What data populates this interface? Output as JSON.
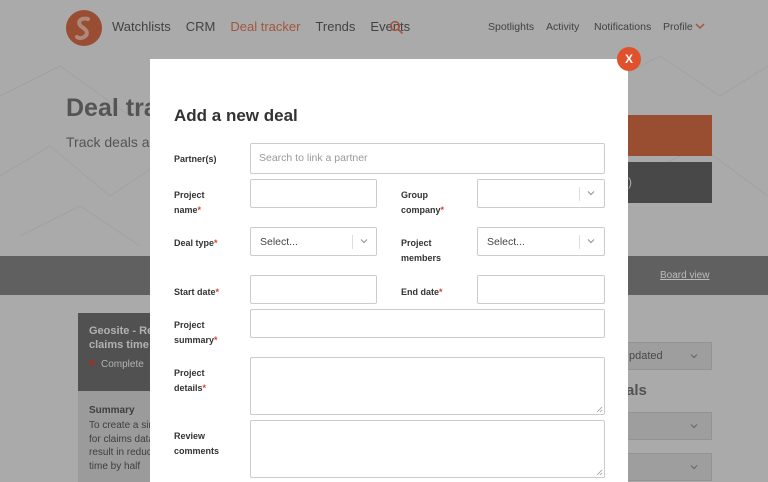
{
  "nav": {
    "items": [
      "Watchlists",
      "CRM",
      "Deal tracker",
      "Trends",
      "Events"
    ],
    "active": "Deal tracker",
    "right": [
      "Spotlights",
      "Activity",
      "Notifications",
      "Profile"
    ]
  },
  "hero": {
    "title": "Deal tra",
    "subtitle": "Track deals a",
    "gray_button_fragment": ")"
  },
  "band": {
    "board_view": "Board view"
  },
  "card": {
    "title": "Geosite - Rec claims time",
    "status": "Complete",
    "summary_label": "Summary",
    "summary": "To create a sin for claims data result in reduc time by half"
  },
  "sidebar": {
    "sort_value": "pdated",
    "filters_title": "als"
  },
  "modal": {
    "title": "Add a new deal",
    "close_label": "X",
    "required_mark": "*",
    "labels": {
      "partners": "Partner(s)",
      "project_name": "Project name",
      "group_company": "Group company",
      "deal_type": "Deal type",
      "project_members": "Project members",
      "start_date": "Start date",
      "end_date": "End date",
      "project_summary": "Project summary",
      "project_details": "Project details",
      "review_comments": "Review comments"
    },
    "placeholders": {
      "partners": "Search to link a partner"
    },
    "values": {
      "deal_type": "Select...",
      "project_members": "Select..."
    }
  },
  "colors": {
    "accent": "#e0522b",
    "brand": "#b8532f",
    "required": "#d9442a"
  }
}
